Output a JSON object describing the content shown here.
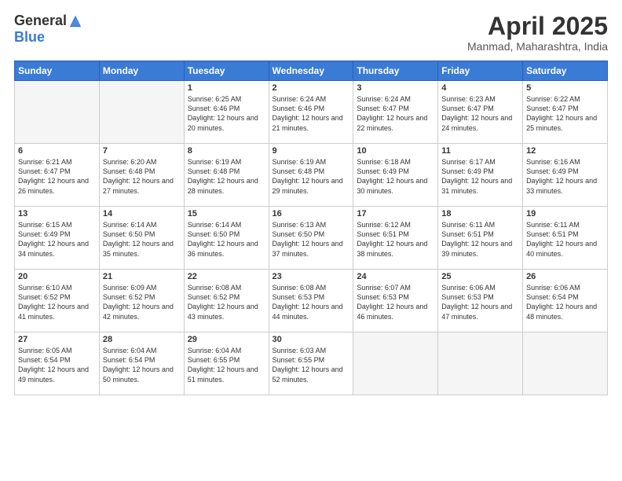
{
  "header": {
    "logo_general": "General",
    "logo_blue": "Blue",
    "title": "April 2025",
    "location": "Manmad, Maharashtra, India"
  },
  "days_of_week": [
    "Sunday",
    "Monday",
    "Tuesday",
    "Wednesday",
    "Thursday",
    "Friday",
    "Saturday"
  ],
  "weeks": [
    [
      {
        "day": "",
        "info": ""
      },
      {
        "day": "",
        "info": ""
      },
      {
        "day": "1",
        "info": "Sunrise: 6:25 AM\nSunset: 6:46 PM\nDaylight: 12 hours and 20 minutes."
      },
      {
        "day": "2",
        "info": "Sunrise: 6:24 AM\nSunset: 6:46 PM\nDaylight: 12 hours and 21 minutes."
      },
      {
        "day": "3",
        "info": "Sunrise: 6:24 AM\nSunset: 6:47 PM\nDaylight: 12 hours and 22 minutes."
      },
      {
        "day": "4",
        "info": "Sunrise: 6:23 AM\nSunset: 6:47 PM\nDaylight: 12 hours and 24 minutes."
      },
      {
        "day": "5",
        "info": "Sunrise: 6:22 AM\nSunset: 6:47 PM\nDaylight: 12 hours and 25 minutes."
      }
    ],
    [
      {
        "day": "6",
        "info": "Sunrise: 6:21 AM\nSunset: 6:47 PM\nDaylight: 12 hours and 26 minutes."
      },
      {
        "day": "7",
        "info": "Sunrise: 6:20 AM\nSunset: 6:48 PM\nDaylight: 12 hours and 27 minutes."
      },
      {
        "day": "8",
        "info": "Sunrise: 6:19 AM\nSunset: 6:48 PM\nDaylight: 12 hours and 28 minutes."
      },
      {
        "day": "9",
        "info": "Sunrise: 6:19 AM\nSunset: 6:48 PM\nDaylight: 12 hours and 29 minutes."
      },
      {
        "day": "10",
        "info": "Sunrise: 6:18 AM\nSunset: 6:49 PM\nDaylight: 12 hours and 30 minutes."
      },
      {
        "day": "11",
        "info": "Sunrise: 6:17 AM\nSunset: 6:49 PM\nDaylight: 12 hours and 31 minutes."
      },
      {
        "day": "12",
        "info": "Sunrise: 6:16 AM\nSunset: 6:49 PM\nDaylight: 12 hours and 33 minutes."
      }
    ],
    [
      {
        "day": "13",
        "info": "Sunrise: 6:15 AM\nSunset: 6:49 PM\nDaylight: 12 hours and 34 minutes."
      },
      {
        "day": "14",
        "info": "Sunrise: 6:14 AM\nSunset: 6:50 PM\nDaylight: 12 hours and 35 minutes."
      },
      {
        "day": "15",
        "info": "Sunrise: 6:14 AM\nSunset: 6:50 PM\nDaylight: 12 hours and 36 minutes."
      },
      {
        "day": "16",
        "info": "Sunrise: 6:13 AM\nSunset: 6:50 PM\nDaylight: 12 hours and 37 minutes."
      },
      {
        "day": "17",
        "info": "Sunrise: 6:12 AM\nSunset: 6:51 PM\nDaylight: 12 hours and 38 minutes."
      },
      {
        "day": "18",
        "info": "Sunrise: 6:11 AM\nSunset: 6:51 PM\nDaylight: 12 hours and 39 minutes."
      },
      {
        "day": "19",
        "info": "Sunrise: 6:11 AM\nSunset: 6:51 PM\nDaylight: 12 hours and 40 minutes."
      }
    ],
    [
      {
        "day": "20",
        "info": "Sunrise: 6:10 AM\nSunset: 6:52 PM\nDaylight: 12 hours and 41 minutes."
      },
      {
        "day": "21",
        "info": "Sunrise: 6:09 AM\nSunset: 6:52 PM\nDaylight: 12 hours and 42 minutes."
      },
      {
        "day": "22",
        "info": "Sunrise: 6:08 AM\nSunset: 6:52 PM\nDaylight: 12 hours and 43 minutes."
      },
      {
        "day": "23",
        "info": "Sunrise: 6:08 AM\nSunset: 6:53 PM\nDaylight: 12 hours and 44 minutes."
      },
      {
        "day": "24",
        "info": "Sunrise: 6:07 AM\nSunset: 6:53 PM\nDaylight: 12 hours and 46 minutes."
      },
      {
        "day": "25",
        "info": "Sunrise: 6:06 AM\nSunset: 6:53 PM\nDaylight: 12 hours and 47 minutes."
      },
      {
        "day": "26",
        "info": "Sunrise: 6:06 AM\nSunset: 6:54 PM\nDaylight: 12 hours and 48 minutes."
      }
    ],
    [
      {
        "day": "27",
        "info": "Sunrise: 6:05 AM\nSunset: 6:54 PM\nDaylight: 12 hours and 49 minutes."
      },
      {
        "day": "28",
        "info": "Sunrise: 6:04 AM\nSunset: 6:54 PM\nDaylight: 12 hours and 50 minutes."
      },
      {
        "day": "29",
        "info": "Sunrise: 6:04 AM\nSunset: 6:55 PM\nDaylight: 12 hours and 51 minutes."
      },
      {
        "day": "30",
        "info": "Sunrise: 6:03 AM\nSunset: 6:55 PM\nDaylight: 12 hours and 52 minutes."
      },
      {
        "day": "",
        "info": ""
      },
      {
        "day": "",
        "info": ""
      },
      {
        "day": "",
        "info": ""
      }
    ]
  ]
}
